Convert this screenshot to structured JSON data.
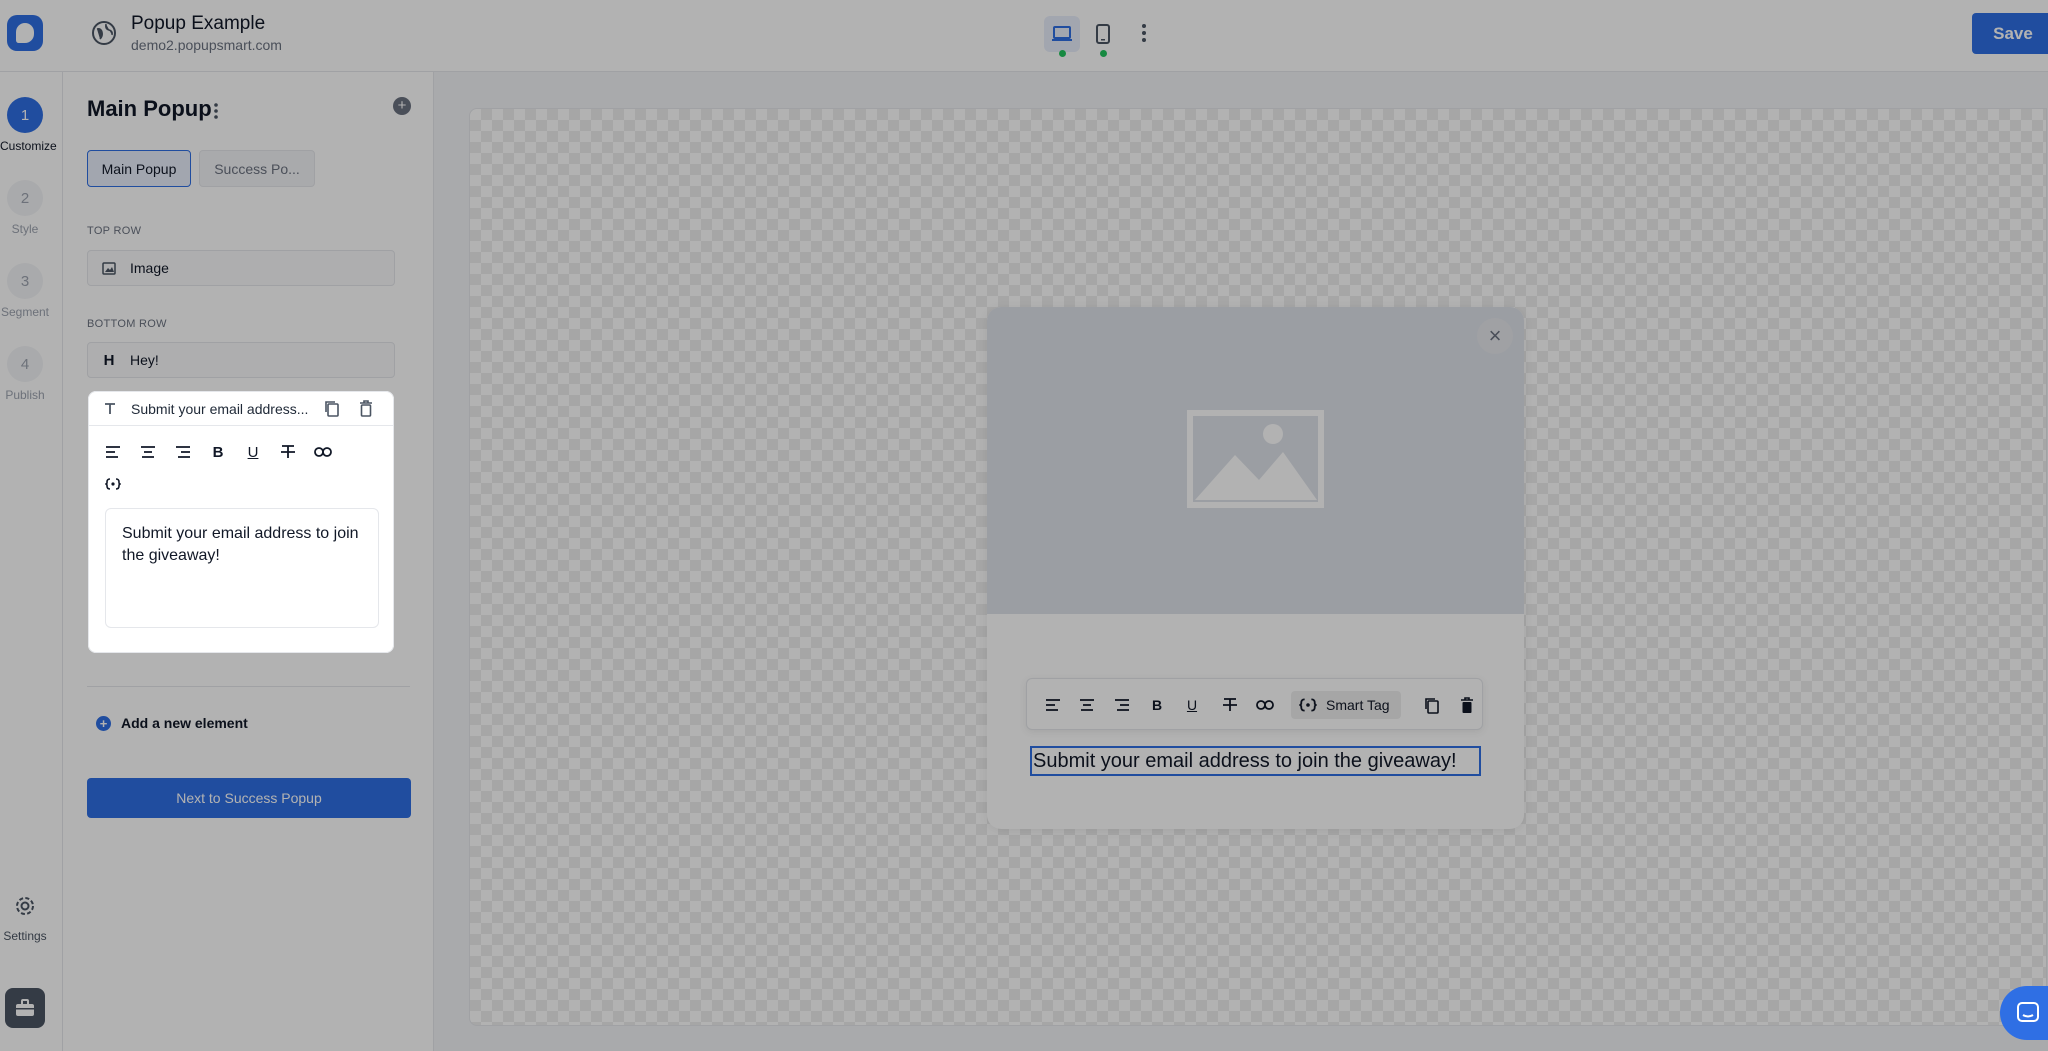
{
  "header": {
    "title": "Popup Example",
    "domain": "demo2.popupsmart.com",
    "save_label": "Save",
    "devices": [
      {
        "name": "desktop-icon",
        "active": true
      },
      {
        "name": "mobile-icon",
        "active": false
      }
    ]
  },
  "steps": [
    {
      "number": "1",
      "label": "Customize",
      "active": true
    },
    {
      "number": "2",
      "label": "Style",
      "active": false
    },
    {
      "number": "3",
      "label": "Segment",
      "active": false
    },
    {
      "number": "4",
      "label": "Publish",
      "active": false
    }
  ],
  "rail": {
    "settings_label": "Settings"
  },
  "panel": {
    "title": "Main Popup",
    "tabs": [
      "Main Popup",
      "Success Po..."
    ],
    "top_row_label": "TOP ROW",
    "top_row_items": [
      {
        "icon": "image-icon",
        "label": "Image"
      }
    ],
    "bottom_row_label": "BOTTOM ROW",
    "bottom_row_items": [
      {
        "icon": "heading-icon",
        "glyph": "H",
        "label": "Hey!"
      }
    ],
    "text_element": {
      "title": "Submit your email address...",
      "content": "Submit your email address to join the giveaway!"
    },
    "add_element_label": "Add a new element",
    "next_button_label": "Next to Success Popup"
  },
  "popup": {
    "text": "Submit your email address to join the giveaway!",
    "toolbar": {
      "smart_tag_label": "Smart Tag"
    }
  },
  "colors": {
    "accent": "#2f6fe4",
    "status_green": "#22c55e"
  }
}
